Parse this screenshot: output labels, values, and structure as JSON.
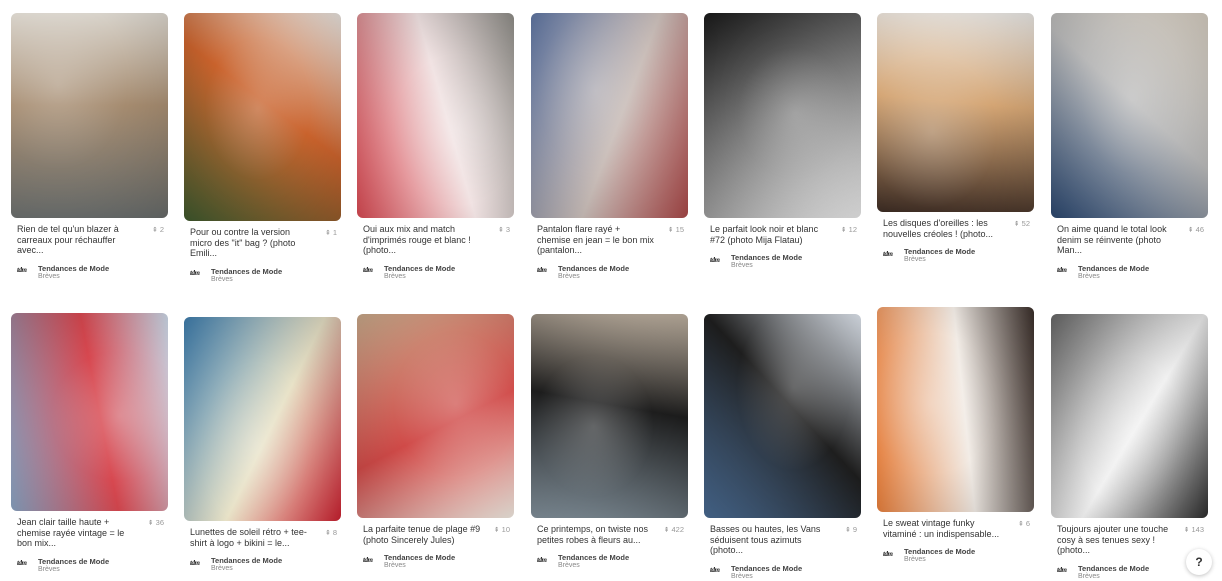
{
  "board": {
    "name": "Tendances de Mode",
    "sub": "Brèves",
    "logo": "tdm"
  },
  "help_label": "?",
  "pins": [
    {
      "desc": "Rien de tel qu'un blazer à carreaux pour réchauffer avec...",
      "count": "2",
      "colors": [
        "#6b6f6e",
        "#a58b6f",
        "#d9d4cc"
      ]
    },
    {
      "desc": "Pour ou contre la version micro des \"it\" bag ? (photo Emili...",
      "count": "1",
      "colors": [
        "#3f5a2e",
        "#c9622c",
        "#ece7e2"
      ]
    },
    {
      "desc": "Oui aux mix and match d'imprimés rouge et blanc ! (photo...",
      "count": "3",
      "colors": [
        "#d94a53",
        "#f1e3e3",
        "#8c8a85"
      ]
    },
    {
      "desc": "Pantalon flare rayé + chemise en jean = le bon mix (pantalon...",
      "count": "15",
      "colors": [
        "#5a6f99",
        "#c9bdb8",
        "#b04b4b"
      ]
    },
    {
      "desc": "Le parfait look noir et blanc #72 (photo Mija Flatau)",
      "count": "12",
      "colors": [
        "#1b1b1b",
        "#8a8a8a",
        "#e8e8e8"
      ]
    },
    {
      "desc": "Les disques d'oreilles : les nouvelles créoles ! (photo...",
      "count": "52",
      "colors": [
        "#3a2a22",
        "#d4a574",
        "#f3f1ee"
      ]
    },
    {
      "desc": "On aime quand le total look denim se réinvente (photo Man...",
      "count": "46",
      "colors": [
        "#2d4a73",
        "#b9b9b9",
        "#d0c8bc"
      ]
    },
    {
      "desc": "Jean clair taille haute + chemise rayée vintage = le bon mix...",
      "count": "36",
      "colors": [
        "#8fa9c9",
        "#d7474f",
        "#c7d4e3"
      ]
    },
    {
      "desc": "Lunettes de soleil rétro + tee-shirt à logo + bikini = le...",
      "count": "8",
      "colors": [
        "#3f7fb0",
        "#e8e2c7",
        "#c7202f"
      ]
    },
    {
      "desc": "La parfaite tenue de plage #9 (photo Sincerely Jules)",
      "count": "10",
      "colors": [
        "#c9a98a",
        "#d04a48",
        "#efe8df"
      ]
    },
    {
      "desc": "Ce printemps, on twiste nos petites robes à fleurs au...",
      "count": "422",
      "colors": [
        "#7d8b95",
        "#1d1d1d",
        "#c7b9a8"
      ]
    },
    {
      "desc": "Basses ou hautes, les Vans séduisent tous azimuts (photo...",
      "count": "9",
      "colors": [
        "#4c6f98",
        "#1e1e1e",
        "#d5dbe3"
      ]
    },
    {
      "desc": "Le sweat vintage funky vitaminé : un indispensable...",
      "count": "6",
      "colors": [
        "#e57d3a",
        "#f2ece6",
        "#3b2f2a"
      ]
    },
    {
      "desc": "Toujours ajouter une touche cosy à ses tenues sexy ! (photo...",
      "count": "143",
      "colors": [
        "#6a6a6a",
        "#f1f1f1",
        "#2c2c2c"
      ]
    }
  ]
}
